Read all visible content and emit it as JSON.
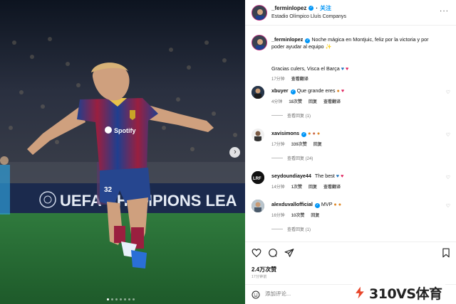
{
  "photo": {
    "board_text": "UEFA CHAMPIONS LEA",
    "shirt_sponsor": "Spotify",
    "shorts_number": "32",
    "slide_dots": 7,
    "active_dot": 0
  },
  "header": {
    "username": "_ferminlopez",
    "follow_label": "关注",
    "location": "Estadio Olímpico Lluís Companys",
    "more": "···"
  },
  "caption": {
    "username": "_ferminlopez",
    "text": "Noche mágica en Montjuic, feliz por la victoria y por poder ayudar al equipo ✨",
    "text2_prefix": "Gracias culers, Visca el Barça",
    "time": "17分钟",
    "translate": "查看翻译"
  },
  "comments": [
    {
      "username": "xbuyer",
      "text": "Que grande eres",
      "time": "4分钟",
      "likes": "18次赞",
      "reply": "回复",
      "translate": "查看翻译",
      "view_replies": "查看回复 (1)"
    },
    {
      "username": "xavisimons",
      "text": "",
      "time": "17分钟",
      "likes": "339次赞",
      "reply": "回复",
      "translate": "",
      "view_replies": "查看回复 (24)"
    },
    {
      "username": "seydoundiaye44",
      "text": "The best",
      "time": "14分钟",
      "likes": "1次赞",
      "reply": "回复",
      "translate": "查看翻译",
      "view_replies": ""
    },
    {
      "username": "alexduvallofficial",
      "text": "MVP",
      "time": "16分钟",
      "likes": "10次赞",
      "reply": "回复",
      "translate": "",
      "view_replies": "查看回复 (1)"
    }
  ],
  "actions": {
    "likes": "2.4万次赞",
    "time": "17分钟前",
    "comment_placeholder": "添加评论..."
  },
  "watermark": {
    "text": "310VS体育"
  }
}
